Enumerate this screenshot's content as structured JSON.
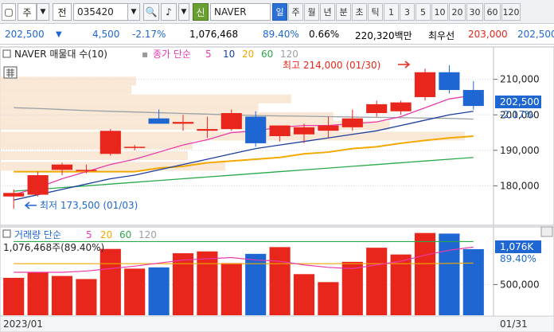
{
  "toolbar": {
    "market_label": "주",
    "type_label": "전",
    "code": "035420",
    "mode_badge": "신",
    "name": "NAVER",
    "periods": [
      "일",
      "주",
      "월",
      "년",
      "분",
      "초",
      "틱",
      "1",
      "3",
      "5",
      "10",
      "20",
      "30",
      "60",
      "120"
    ],
    "active_period": "일"
  },
  "quote": {
    "price": "202,500",
    "change": "4,500",
    "change_pct": "-2.17%",
    "volume": "1,076,468",
    "vol_ratio": "89.40%",
    "turnover": "0.66%",
    "amount": "220,320백만",
    "bid_label": "최우선",
    "bid": "203,000",
    "ask": "202,500"
  },
  "price_panel": {
    "title": "NAVER 매물대 수(10)",
    "ma_label": "종가 단순",
    "ma_periods": [
      "5",
      "10",
      "20",
      "60",
      "120"
    ],
    "high_note": "최고 214,000 (01/30)",
    "low_note": "최저 173,500 (01/03)",
    "current_price_tag": "202,500",
    "current_pct_tag": "-2.17%",
    "y_ticks": [
      "210,000",
      "200,000",
      "190,000",
      "180,000"
    ]
  },
  "volume_panel": {
    "title": "거래량 단순",
    "ma_periods": [
      "5",
      "20",
      "60",
      "120"
    ],
    "info": "1,076,468주(89.40%)",
    "tag_value": "1,076K",
    "tag_pct": "89.40%",
    "y_ticks": [
      "500,000"
    ]
  },
  "x_axis": {
    "start_label": "2023/01",
    "end_label": "01/31"
  },
  "colors": {
    "up": "#e8261c",
    "down": "#1e67d2",
    "ma5": "#e83aa9",
    "ma10": "#1d3f9e",
    "ma20": "#f3a800",
    "ma60": "#2aa84a",
    "ma120": "#9aa0a6",
    "accent": "#2b6fd6"
  },
  "chart_data": {
    "type": "candlestick",
    "y_range": [
      170000,
      218000
    ],
    "volume_range": [
      0,
      1400000
    ],
    "candles": [
      {
        "o": 177000,
        "h": 179000,
        "l": 173500,
        "c": 178000,
        "v": 610000
      },
      {
        "o": 177500,
        "h": 184000,
        "l": 177000,
        "c": 183000,
        "v": 700000
      },
      {
        "o": 184500,
        "h": 186500,
        "l": 183000,
        "c": 186000,
        "v": 640000
      },
      {
        "o": 184500,
        "h": 186000,
        "l": 183500,
        "c": 184500,
        "v": 590000
      },
      {
        "o": 189000,
        "h": 196000,
        "l": 188500,
        "c": 195500,
        "v": 1080000
      },
      {
        "o": 191000,
        "h": 191500,
        "l": 190000,
        "c": 191000,
        "v": 760000
      },
      {
        "o": 199000,
        "h": 201500,
        "l": 197500,
        "c": 197500,
        "v": 780000
      },
      {
        "o": 197500,
        "h": 200000,
        "l": 195500,
        "c": 198000,
        "v": 1010000
      },
      {
        "o": 195500,
        "h": 199500,
        "l": 193500,
        "c": 196000,
        "v": 1040000
      },
      {
        "o": 196000,
        "h": 201500,
        "l": 195500,
        "c": 200500,
        "v": 850000
      },
      {
        "o": 199500,
        "h": 201000,
        "l": 191000,
        "c": 192000,
        "v": 1000000
      },
      {
        "o": 194000,
        "h": 197000,
        "l": 192500,
        "c": 197000,
        "v": 1110000
      },
      {
        "o": 194500,
        "h": 197500,
        "l": 192000,
        "c": 196500,
        "v": 670000
      },
      {
        "o": 195500,
        "h": 199500,
        "l": 193500,
        "c": 197000,
        "v": 540000
      },
      {
        "o": 196500,
        "h": 201500,
        "l": 195500,
        "c": 199000,
        "v": 870000
      },
      {
        "o": 200500,
        "h": 204000,
        "l": 199500,
        "c": 203000,
        "v": 1100000
      },
      {
        "o": 201000,
        "h": 204000,
        "l": 200000,
        "c": 203500,
        "v": 990000
      },
      {
        "o": 205000,
        "h": 213000,
        "l": 204000,
        "c": 212000,
        "v": 1340000
      },
      {
        "o": 212000,
        "h": 214000,
        "l": 206000,
        "c": 207000,
        "v": 1330000
      },
      {
        "o": 207000,
        "h": 209500,
        "l": 201500,
        "c": 202500,
        "v": 1076468
      }
    ],
    "ma5": [
      177500,
      179500,
      182000,
      184000,
      186000,
      187500,
      189500,
      191500,
      193000,
      195000,
      195500,
      196500,
      197000,
      197000,
      197500,
      198000,
      199500,
      202000,
      204500,
      205500
    ],
    "ma10": [
      176000,
      177500,
      179000,
      180500,
      182000,
      183000,
      184500,
      186000,
      187500,
      189000,
      190500,
      191500,
      192500,
      193500,
      194500,
      195500,
      197000,
      198500,
      200000,
      201000
    ],
    "ma20": [
      184000,
      184000,
      184000,
      184000,
      184000,
      184000,
      185000,
      185500,
      186500,
      187000,
      187500,
      188000,
      189000,
      189500,
      190500,
      191000,
      192000,
      192800,
      193500,
      194000
    ],
    "ma60": [
      178500,
      179000,
      179500,
      180000,
      180500,
      181000,
      181500,
      182000,
      182500,
      183000,
      183500,
      184000,
      184500,
      185000,
      185500,
      186000,
      186500,
      187000,
      187500,
      188000
    ],
    "ma120": [
      202000,
      201800,
      201500,
      201200,
      201000,
      200800,
      200600,
      200400,
      200200,
      200000,
      199800,
      199700,
      199600,
      199500,
      199400,
      199300,
      199200,
      199100,
      199000,
      198800
    ],
    "vol_ma5": [
      700000,
      700000,
      700000,
      720000,
      760000,
      800000,
      850000,
      900000,
      920000,
      940000,
      900000,
      880000,
      820000,
      780000,
      760000,
      820000,
      880000,
      980000,
      1060000,
      1110000
    ],
    "vol_ma20": [
      840000,
      840000,
      840000,
      840000,
      840000,
      840000,
      840000,
      840000,
      840000,
      840000,
      840000,
      840000,
      840000,
      840000,
      840000,
      840000,
      840000,
      840000,
      845000,
      850000
    ],
    "vol_ma60": [
      1200000,
      1200000,
      1200000,
      1200000,
      1200000,
      1200000,
      1200000,
      1200000,
      1200000,
      1200000,
      1200000,
      1200000,
      1200000,
      1200000,
      1200000,
      1200000,
      1200000,
      1200000,
      1200000,
      1200000
    ],
    "volume_profile": [
      {
        "price": 209500,
        "w": 0.29
      },
      {
        "price": 207000,
        "w": 0.28
      },
      {
        "price": 204500,
        "w": 0.62
      },
      {
        "price": 202000,
        "w": 0.55
      },
      {
        "price": 199500,
        "w": 0.71
      },
      {
        "price": 197000,
        "w": 0.83
      },
      {
        "price": 194000,
        "w": 0.99
      },
      {
        "price": 191500,
        "w": 0.41
      },
      {
        "price": 188500,
        "w": 0.4
      },
      {
        "price": 185500,
        "w": 0.48
      }
    ]
  }
}
